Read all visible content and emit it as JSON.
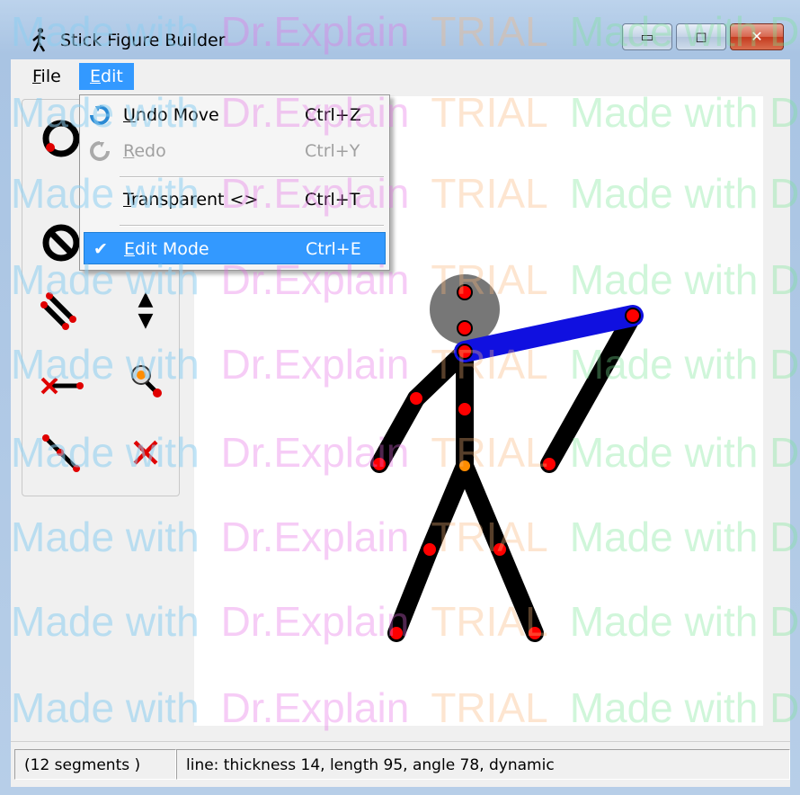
{
  "window": {
    "title": "Stick Figure Builder"
  },
  "title_buttons": {
    "minimize_glyph": "▭",
    "maximize_glyph": "◻",
    "close_glyph": "✕"
  },
  "menubar": {
    "file": {
      "hotkey": "F",
      "rest": "ile"
    },
    "edit": {
      "hotkey": "E",
      "rest": "dit"
    }
  },
  "edit_menu": {
    "items": [
      {
        "label_hotkey": "U",
        "label_rest": "ndo Move",
        "shortcut": "Ctrl+Z",
        "icon": "undo-icon",
        "enabled": true
      },
      {
        "label_hotkey": "R",
        "label_rest": "edo",
        "shortcut": "Ctrl+Y",
        "icon": "redo-icon",
        "enabled": false
      },
      {
        "label_hotkey": "T",
        "label_rest": "ransparent <>",
        "shortcut": "Ctrl+T",
        "enabled": true
      },
      {
        "label_hotkey": "E",
        "label_rest": "dit Mode",
        "shortcut": "Ctrl+E",
        "checked": true,
        "selected": true
      }
    ],
    "check_glyph": "✔"
  },
  "toolbox": {
    "tools": [
      "add-circle-tool-icon",
      "delete-circle-tool-icon",
      "add-line-tool-icon",
      "move-up-down-tool-icon",
      "detach-line-tool-icon",
      "move-joint-tool-icon",
      "add-joint-line-tool-icon",
      "delete-tool-icon"
    ],
    "arrow_up": "▲",
    "arrow_down": "▼",
    "x_mark": "✕"
  },
  "status": {
    "segments": "(12 segments )",
    "info": "line: thickness 14, length 95, angle 78, dynamic"
  },
  "watermark": {
    "part1": "Made with",
    "part2": "Dr.Explain",
    "part3": "TRIAL",
    "part4": "Made with D"
  },
  "colors": {
    "selection": "#3399ff",
    "figure": "#000000",
    "selected_segment": "#1010e0",
    "joint": "#ff0000",
    "center_joint": "#ff8c00",
    "head": "#777777"
  }
}
